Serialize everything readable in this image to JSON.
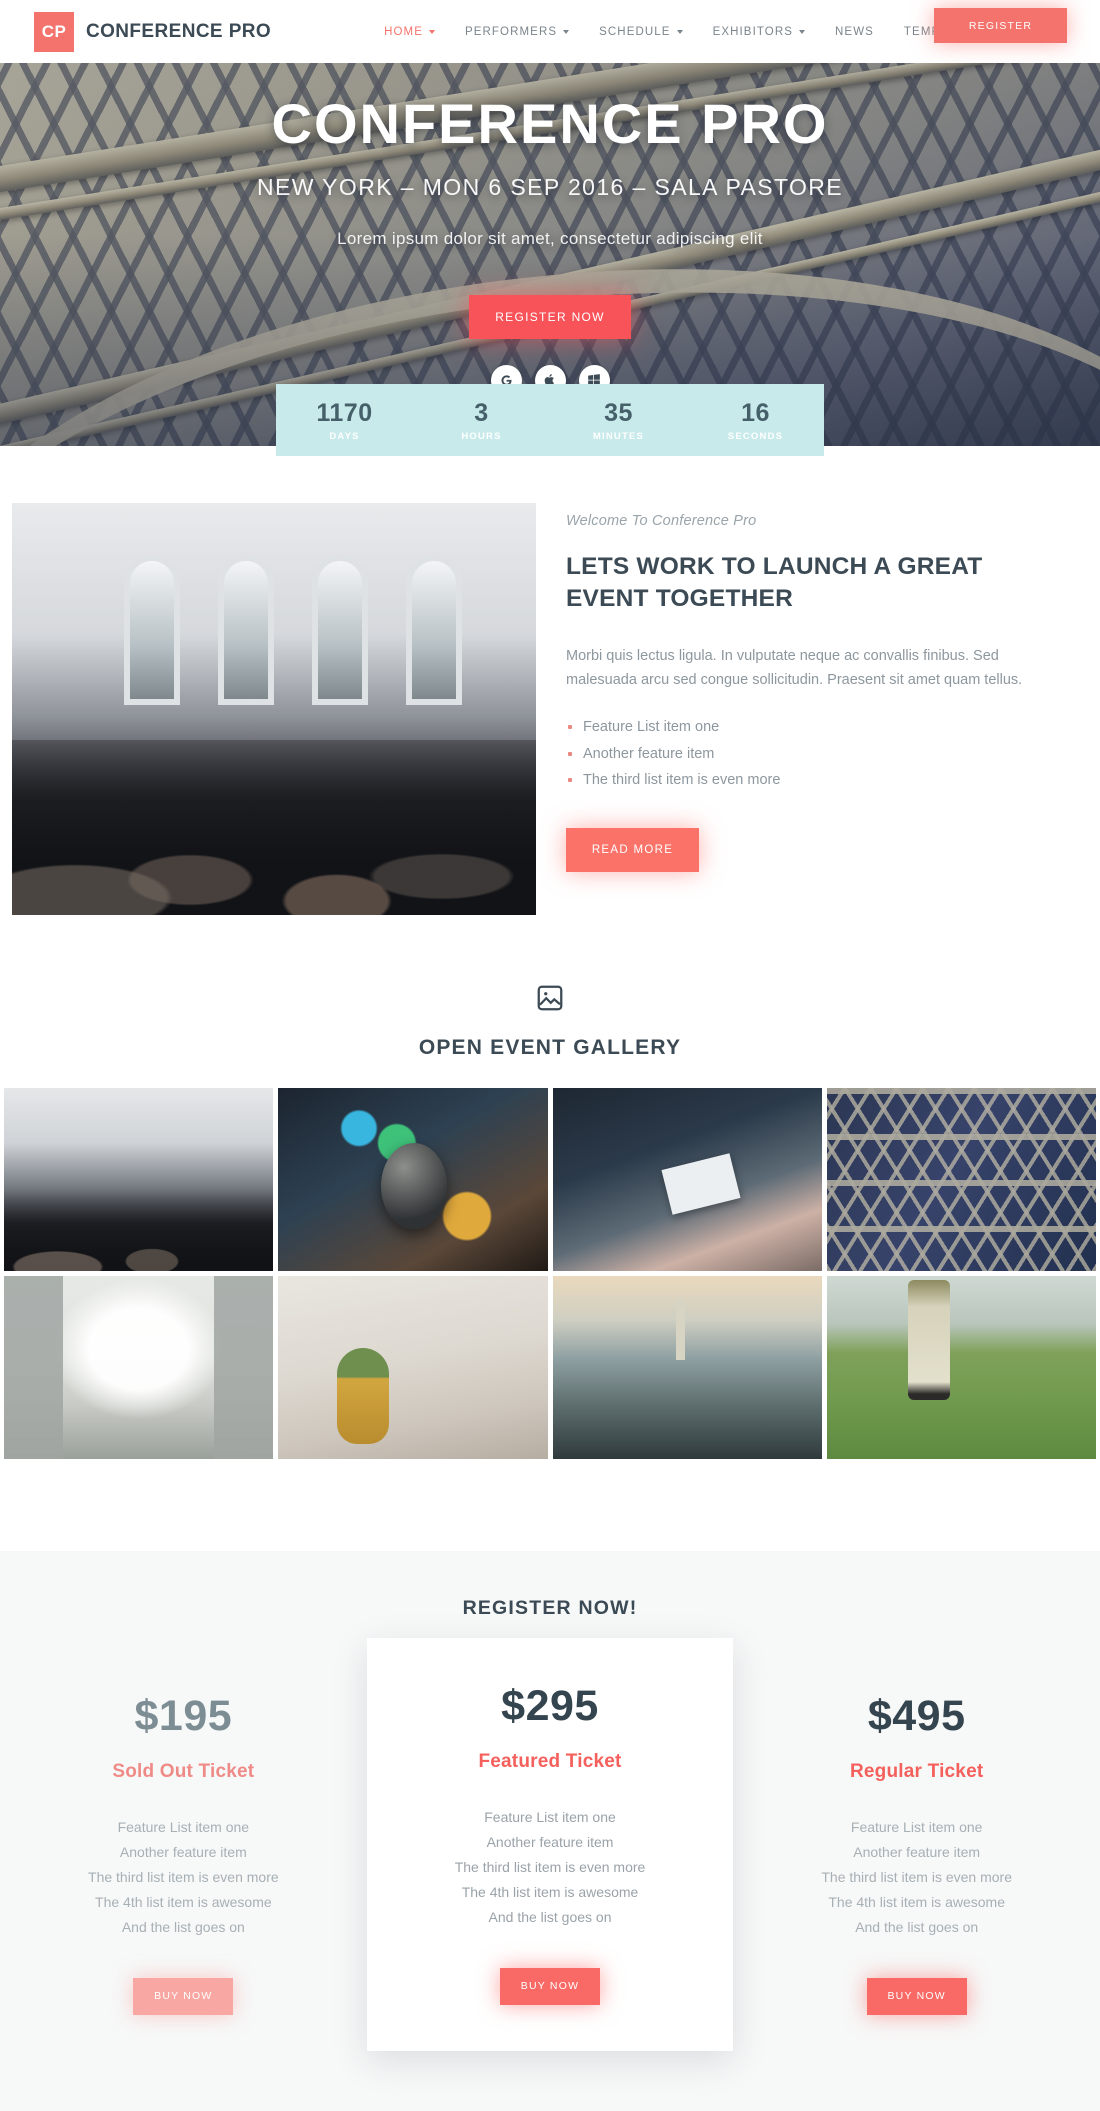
{
  "header": {
    "logo_mark": "CP",
    "brand_name": "CONFERENCE PRO",
    "accent_color": "#f4736c",
    "nav": [
      {
        "label": "HOME",
        "has_caret": true,
        "active": true
      },
      {
        "label": "PERFORMERS",
        "has_caret": true,
        "active": false
      },
      {
        "label": "SCHEDULE",
        "has_caret": true,
        "active": false
      },
      {
        "label": "EXHIBITORS",
        "has_caret": true,
        "active": false
      },
      {
        "label": "NEWS",
        "has_caret": false,
        "active": false
      },
      {
        "label": "TEMPLATES",
        "has_caret": false,
        "active": false
      }
    ],
    "register_label": "REGISTER"
  },
  "hero": {
    "title": "CONFERENCE PRO",
    "subtitle": "NEW YORK – MON 6 SEP 2016 – SALA PASTORE",
    "description": "Lorem ipsum dolor sit amet, consectetur adipiscing elit",
    "cta_label": "REGISTER NOW",
    "socials": [
      {
        "name": "google-icon",
        "glyph": "G"
      },
      {
        "name": "apple-icon",
        "glyph": ""
      },
      {
        "name": "windows-icon",
        "glyph": ""
      }
    ]
  },
  "countdown": {
    "background_color": "#c8eaea",
    "cells": [
      {
        "value": "1170",
        "label": "DAYS"
      },
      {
        "value": "3",
        "label": "HOURS"
      },
      {
        "value": "35",
        "label": "MINUTES"
      },
      {
        "value": "16",
        "label": "SECONDS"
      }
    ]
  },
  "about": {
    "kicker": "Welcome To Conference Pro",
    "heading": "LETS WORK TO LAUNCH A GREAT EVENT TOGETHER",
    "paragraph": "Morbi quis lectus ligula. In vulputate neque ac convallis finibus. Sed malesuada arcu sed congue sollicitudin. Praesent sit amet quam tellus.",
    "features": [
      "Feature List item one",
      "Another feature item",
      "The third list item is even more"
    ],
    "button_label": "READ MORE",
    "image_alt": "conference hall crowd"
  },
  "gallery": {
    "title": "OPEN EVENT GALLERY",
    "icon": "image-icon",
    "tiles": [
      {
        "alt": "conference hall crowd"
      },
      {
        "alt": "microphone on stage"
      },
      {
        "alt": "hands taking notes"
      },
      {
        "alt": "eiffel tower structure"
      },
      {
        "alt": "city street traffic"
      },
      {
        "alt": "pineapple on concrete wall"
      },
      {
        "alt": "san francisco coit tower hillside"
      },
      {
        "alt": "golfer walking on green"
      }
    ]
  },
  "pricing": {
    "title": "REGISTER NOW!",
    "buy_label": "BUY NOW",
    "plans": [
      {
        "price": "$195",
        "name": "Sold Out Ticket",
        "featured": false,
        "features": [
          "Feature List item one",
          "Another feature item",
          "The third list item is even more",
          "The 4th list item is awesome",
          "And the list goes on"
        ]
      },
      {
        "price": "$295",
        "name": "Featured Ticket",
        "featured": true,
        "features": [
          "Feature List item one",
          "Another feature item",
          "The third list item is even more",
          "The 4th list item is awesome",
          "And the list goes on"
        ]
      },
      {
        "price": "$495",
        "name": "Regular Ticket",
        "featured": false,
        "features": [
          "Feature List item one",
          "Another feature item",
          "The third list item is even more",
          "The 4th list item is awesome",
          "And the list goes on"
        ]
      }
    ]
  }
}
